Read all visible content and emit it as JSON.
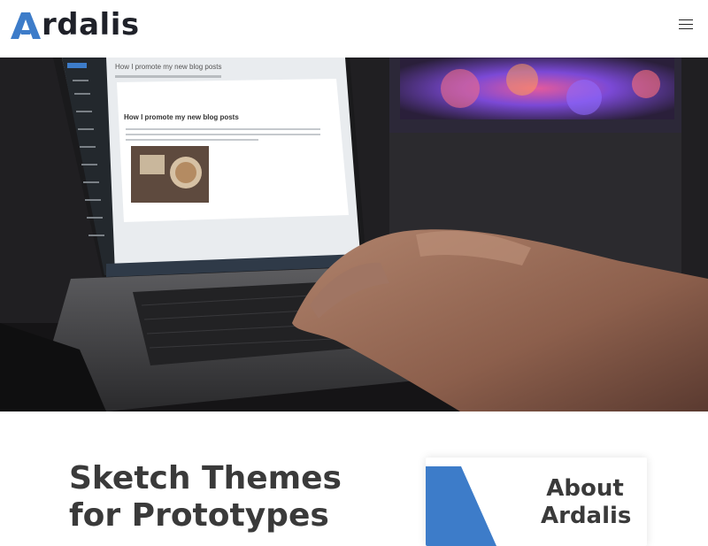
{
  "header": {
    "logo_text": "rdalis",
    "logo_full_name": "Ardalis",
    "menu_icon": "hamburger-menu-icon"
  },
  "hero": {
    "image_description_icon": "hero-photo",
    "screen": {
      "post_title": "How I promote my new blog posts",
      "editor_heading": "How I promote my new blog posts"
    }
  },
  "main": {
    "title": "Sketch Themes for Prototypes"
  },
  "about_card": {
    "title": "About Ardalis"
  },
  "colors": {
    "brand_blue": "#3d7cc9",
    "text_dark": "#3a3a3a"
  }
}
